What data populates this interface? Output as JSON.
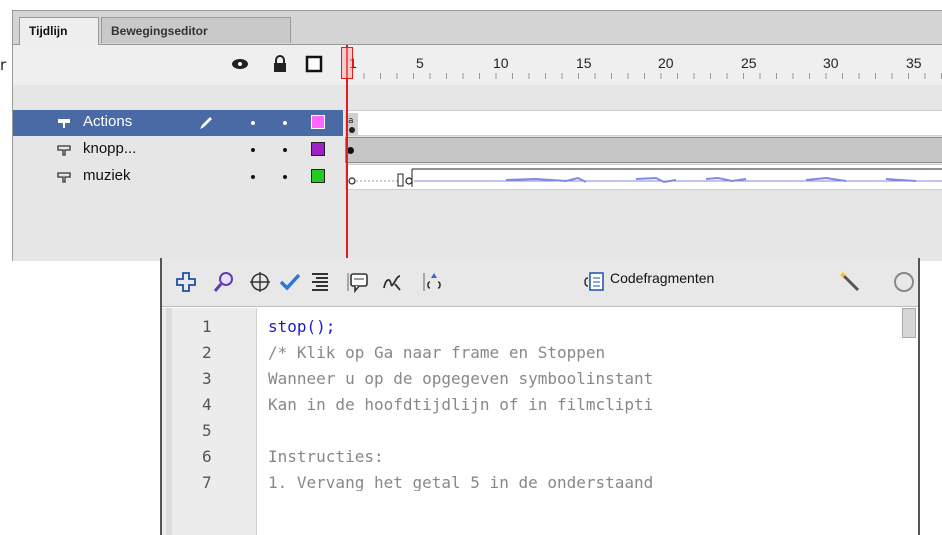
{
  "stray_text": "r",
  "timeline": {
    "tabs": [
      {
        "label": "Tijdlijn",
        "active": true
      },
      {
        "label": "Bewegingseditor",
        "active": false
      }
    ],
    "header_icons": [
      "eye-icon",
      "lock-icon",
      "outline-icon"
    ],
    "ruler": {
      "labels": [
        "1",
        "5",
        "10",
        "15",
        "20",
        "25",
        "30",
        "35"
      ]
    },
    "current_frame": 1,
    "layers": [
      {
        "name": "Actions",
        "selected": true,
        "color": "#ff66ff",
        "editing_icon": "pencil-icon"
      },
      {
        "name": "knopp...",
        "selected": false,
        "color": "#a020c8"
      },
      {
        "name": "muziek",
        "selected": false,
        "color": "#22cc22"
      }
    ]
  },
  "actions_panel": {
    "toolbar_icons": [
      "add-icon",
      "find-icon",
      "target-icon",
      "check-syntax-icon",
      "auto-format-icon",
      "code-hint-icon",
      "debug-icon",
      "collapse-icon"
    ],
    "snippets_label": "Codefragmenten",
    "code_lines": [
      {
        "num": "1",
        "text": "stop();"
      },
      {
        "num": "2",
        "text": "/* Klik op Ga naar frame en Stoppen"
      },
      {
        "num": "3",
        "text": "Wanneer u op de opgegeven symboolinstant"
      },
      {
        "num": "4",
        "text": "Kan in de hoofdtijdlijn of in filmclipti"
      },
      {
        "num": "5",
        "text": ""
      },
      {
        "num": "6",
        "text": "Instructies:"
      },
      {
        "num": "7",
        "text": "1. Vervang het getal 5 in de onderstaand"
      }
    ]
  },
  "colors": {
    "selection": "#4a6aa5",
    "playhead": "#e31b1b",
    "keyword": "#1d1dc8",
    "comment": "#888888"
  }
}
